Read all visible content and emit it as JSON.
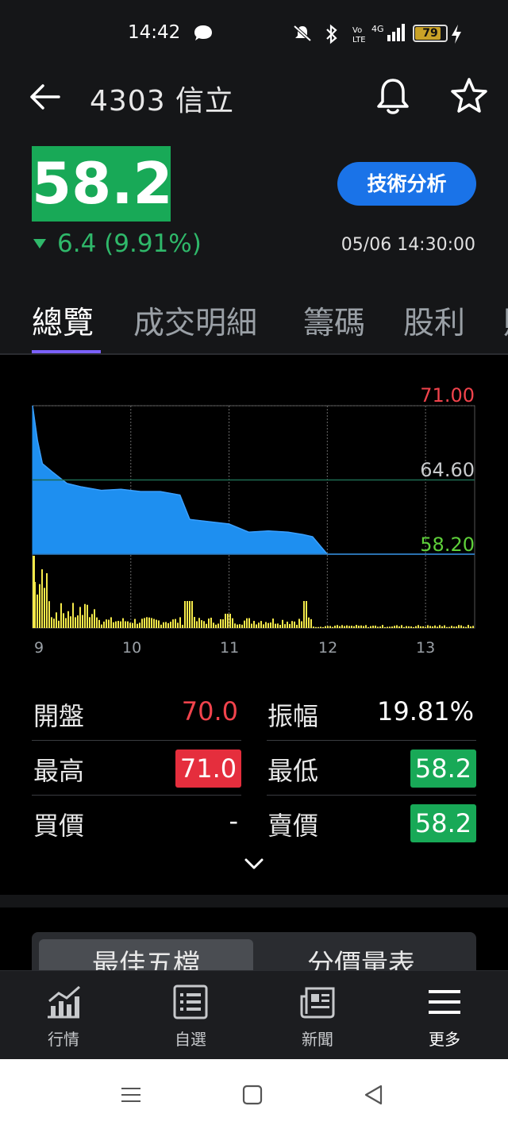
{
  "status_bar": {
    "time": "14:42",
    "battery": "79",
    "icons": [
      "chat-icon",
      "mute-icon",
      "bluetooth-icon",
      "volte-icon",
      "4g-signal-icon",
      "battery-icon",
      "charging-icon"
    ]
  },
  "header": {
    "title": "4303 信立",
    "price": "58.2",
    "change": "6.4 (9.91%)",
    "timestamp": "05/06 14:30:00",
    "tech_button": "技術分析"
  },
  "tabs": [
    {
      "label": "總覽",
      "active": true
    },
    {
      "label": "成交明細",
      "active": false
    },
    {
      "label": "籌碼",
      "active": false
    },
    {
      "label": "股利",
      "active": false
    },
    {
      "label": "財",
      "active": false
    }
  ],
  "chart": {
    "y_labels": {
      "high": "71.00",
      "ref": "64.60",
      "low": "58.20"
    },
    "x_labels": [
      "9",
      "10",
      "11",
      "12",
      "13"
    ]
  },
  "chart_data": {
    "type": "area",
    "title": "",
    "xlabel": "",
    "ylabel": "",
    "x": [
      9.0,
      9.05,
      9.1,
      9.2,
      9.35,
      9.5,
      9.7,
      9.9,
      10.1,
      10.3,
      10.5,
      10.6,
      10.8,
      11.0,
      11.2,
      11.4,
      11.6,
      11.75,
      11.85,
      12.0,
      12.5,
      13.0,
      13.5
    ],
    "series": [
      {
        "values": [
          71.0,
          68.0,
          66.0,
          65.3,
          64.3,
          64.0,
          63.7,
          63.8,
          63.6,
          63.6,
          63.3,
          61.2,
          61.0,
          60.8,
          60.1,
          60.2,
          60.1,
          59.9,
          59.7,
          58.2,
          58.2,
          58.2,
          58.2
        ]
      }
    ],
    "ylim": [
      58.2,
      71.0
    ],
    "xlim": [
      9.0,
      13.5
    ],
    "reference_line": 64.6,
    "volume_colors": "#f5e94a",
    "area_color": "#1e8ff0"
  },
  "stats": {
    "open_label": "開盤",
    "open_value": "70.0",
    "amplitude_label": "振幅",
    "amplitude_value": "19.81%",
    "high_label": "最高",
    "high_value": "71.0",
    "low_label": "最低",
    "low_value": "58.2",
    "bid_label": "買價",
    "bid_value": "-",
    "ask_label": "賣價",
    "ask_value": "58.2"
  },
  "segmented": {
    "left": "最佳五檔",
    "right": "分價量表"
  },
  "bottom_nav": [
    {
      "label": "行情",
      "icon": "chart-icon"
    },
    {
      "label": "自選",
      "icon": "list-icon"
    },
    {
      "label": "新聞",
      "icon": "news-icon"
    },
    {
      "label": "更多",
      "icon": "menu-icon"
    }
  ],
  "colors": {
    "up": "#f1434c",
    "down": "#18a957",
    "accent": "#1a73e8",
    "tab_underline": "#7b61ff"
  }
}
